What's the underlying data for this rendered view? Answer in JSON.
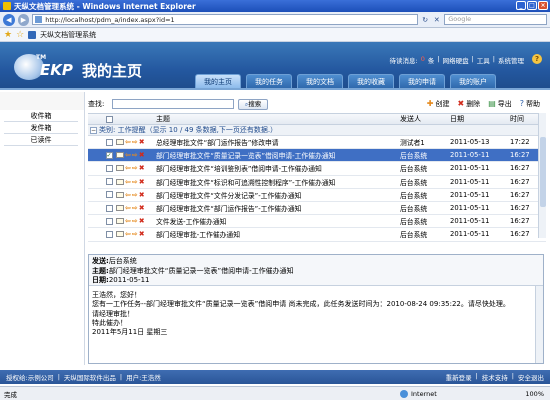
{
  "window": {
    "title": "天纵文档管理系统 - Windows Internet Explorer"
  },
  "browser": {
    "address": "http://localhost/pdm_a/index.aspx?id=1",
    "search_placeholder": "Google",
    "tab_title": "天纵文档管理系统"
  },
  "header": {
    "logo_tm": "TM",
    "logo_mark": "EKP",
    "logo_title": "我的主页",
    "notice_prefix": "待读消息:",
    "notice_count": "0",
    "notice_suffix": "条",
    "links": [
      "网络硬盘",
      "工具",
      "系统管理"
    ],
    "tabs": [
      "我的主页",
      "我的任务",
      "我的文档",
      "我的收藏",
      "我的申请",
      "我的账户"
    ]
  },
  "sidebar": {
    "items": [
      "收件箱",
      "发件箱",
      "已读件"
    ]
  },
  "toolbar": {
    "find_label": "查找:",
    "search_button": "搜索",
    "actions": [
      "创建",
      "删除",
      "导出",
      "帮助"
    ]
  },
  "table": {
    "headers": {
      "subject": "主题",
      "sender": "发送人",
      "date": "日期",
      "time": "时间"
    },
    "group": "类别: 工作提醒（显示 10 / 49 条数据,下一页还有数据.）",
    "rows": [
      {
        "subject": "总经理审批文件“部门运作报告”修改申请",
        "sender": "测试者1",
        "date": "2011-05-13",
        "time": "17:22",
        "selected": false
      },
      {
        "subject": "部门经理审批文件“质量记录一览表”借阅申请-工作催办通知",
        "sender": "后台系统",
        "date": "2011-05-11",
        "time": "16:27",
        "selected": true
      },
      {
        "subject": "部门经理审批文件“培训鉴别表”借阅申请-工作催办通知",
        "sender": "后台系统",
        "date": "2011-05-11",
        "time": "16:27",
        "selected": false
      },
      {
        "subject": "部门经理审批文件“标识和可追溯性控制程序”-工作催办通知",
        "sender": "后台系统",
        "date": "2011-05-11",
        "time": "16:27",
        "selected": false
      },
      {
        "subject": "部门经理审批文件“文件分发记录”-工作催办通知",
        "sender": "后台系统",
        "date": "2011-05-11",
        "time": "16:27",
        "selected": false
      },
      {
        "subject": "部门经理审批文件“部门运作报告”-工作催办通知",
        "sender": "后台系统",
        "date": "2011-05-11",
        "time": "16:27",
        "selected": false
      },
      {
        "subject": "文件发送-工作催办通知",
        "sender": "后台系统",
        "date": "2011-05-11",
        "time": "16:27",
        "selected": false
      },
      {
        "subject": "部门经理审批-工作催办通知",
        "sender": "后台系统",
        "date": "2011-05-11",
        "time": "16:27",
        "selected": false
      }
    ]
  },
  "preview": {
    "sender_label": "发送:",
    "sender": "后台系统",
    "subject_label": "主题:",
    "subject": "部门经理审批文件“质量记录一览表”借阅申请-工作催办通知",
    "date_label": "日期:",
    "date": "2011-05-11",
    "body": [
      "王浩然，您好！",
      "您有一工作任务--部门经理审批文件“质量记录一览表”借阅申请 尚未完成，此任务发送时间为：2010-08-24 09:35:22。请尽快处理。",
      "请经理审批！",
      "特此催办！",
      "2011年5月11日 星期三"
    ]
  },
  "footer": {
    "left": [
      "授权给:示例公司",
      "天纵国际软件出品",
      "用户:王浩然"
    ],
    "right": [
      "重新登录",
      "技术支持",
      "安全退出"
    ]
  },
  "statusbar": {
    "left": "完成",
    "zone": "Internet",
    "zoom": "100%"
  },
  "colors": {
    "header": "#2458a0",
    "selected_row": "#3f6fc4",
    "footer": "#2a5597",
    "alert": "#ff5c4a"
  }
}
